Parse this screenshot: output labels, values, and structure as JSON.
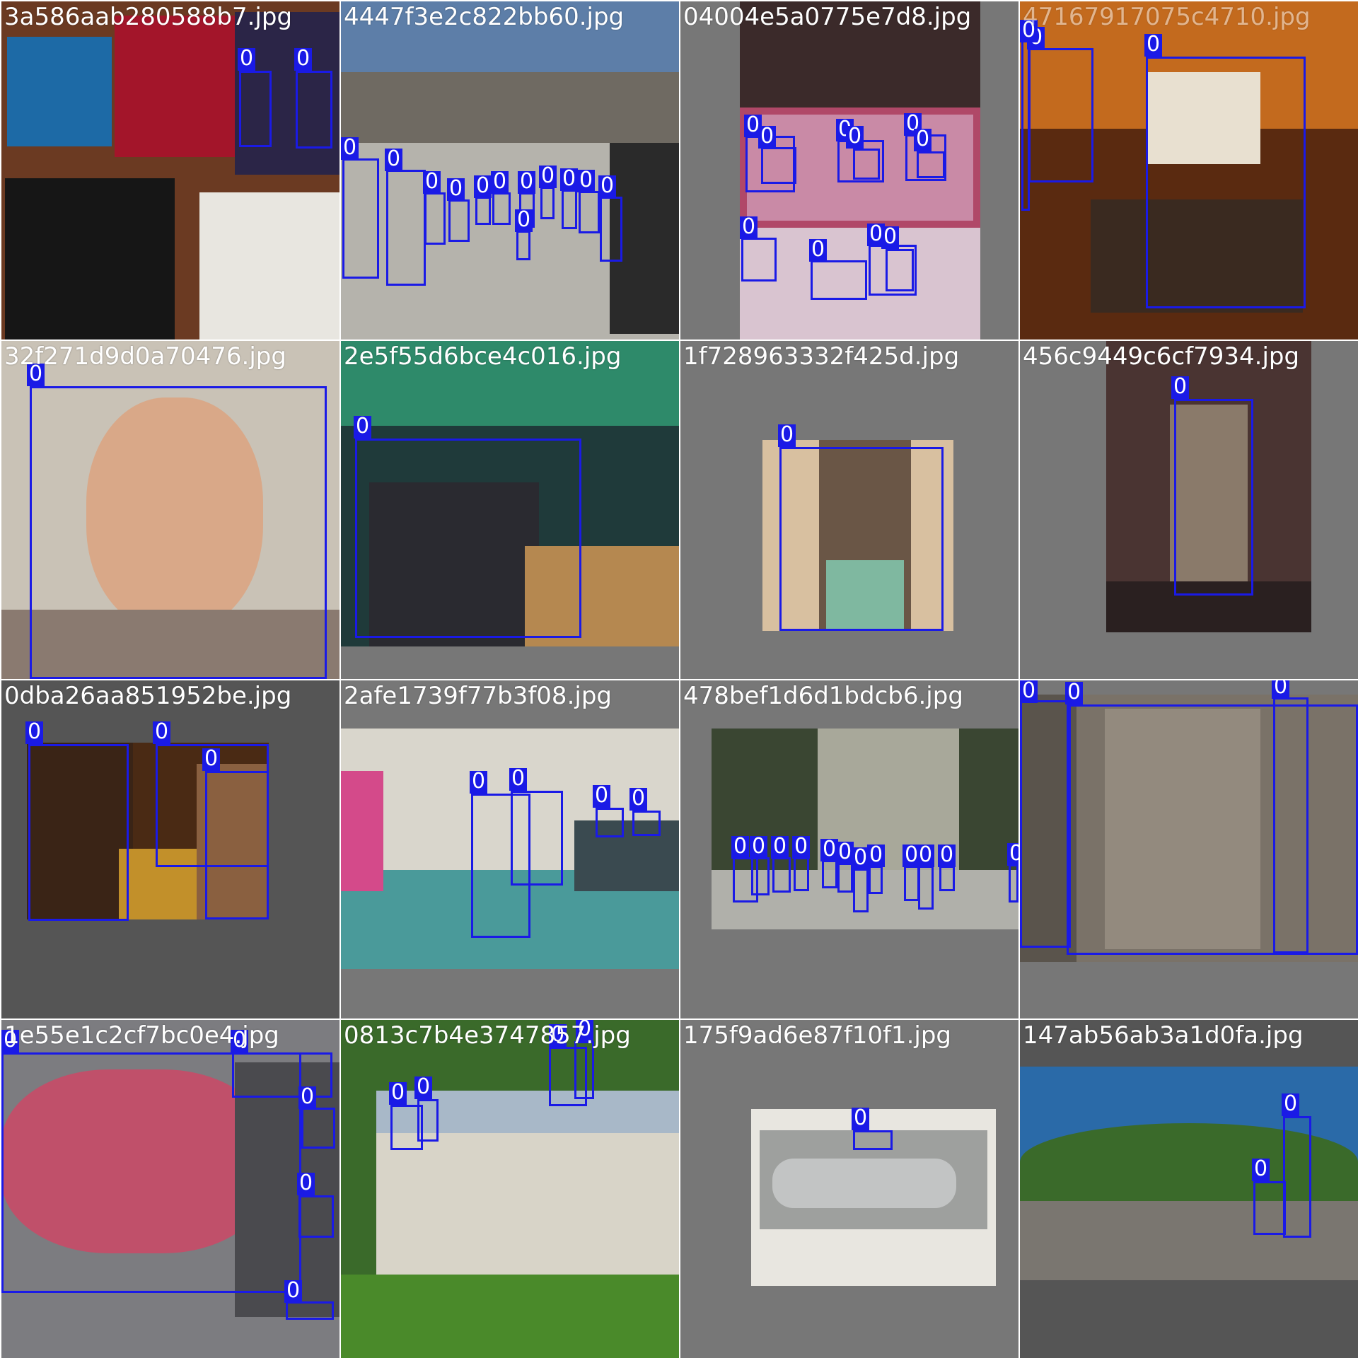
{
  "grid": {
    "tiles": [
      {
        "filename": "3a586aab280588b7.jpg",
        "label": "0"
      },
      {
        "filename": "4447f3e2c822bb60.jpg",
        "label": "0"
      },
      {
        "filename": "04004e5a0775e7d8.jpg",
        "label": "0"
      },
      {
        "filename": "47167917075c4710.jpg",
        "label": "0"
      },
      {
        "filename": "32f271d9d0a70476.jpg",
        "label": "0"
      },
      {
        "filename": "2e5f55d6bce4c016.jpg",
        "label": "0"
      },
      {
        "filename": "1f728963332f425d.jpg",
        "label": "0"
      },
      {
        "filename": "456c9449c6cf7934.jpg",
        "label": "0"
      },
      {
        "filename": "0dba26aa851952be.jpg",
        "label": "0"
      },
      {
        "filename": "2afe1739f77b3f08.jpg",
        "label": "0"
      },
      {
        "filename": "478bef1d6d1bdcb6.jpg",
        "label": "0"
      },
      {
        "filename": "",
        "label": "0"
      },
      {
        "filename": "1e55e1c2cf7bc0e4.jpg",
        "label": "0"
      },
      {
        "filename": "0813c7b4e3747857.jpg",
        "label": "0"
      },
      {
        "filename": "175f9ad6e87f10f1.jpg",
        "label": "0"
      },
      {
        "filename": "147ab56ab3a1d0fa.jpg",
        "label": "0"
      }
    ]
  },
  "colors": {
    "box": "#1a1ae6",
    "background": "#777777",
    "filename_text": "#ffffff"
  }
}
